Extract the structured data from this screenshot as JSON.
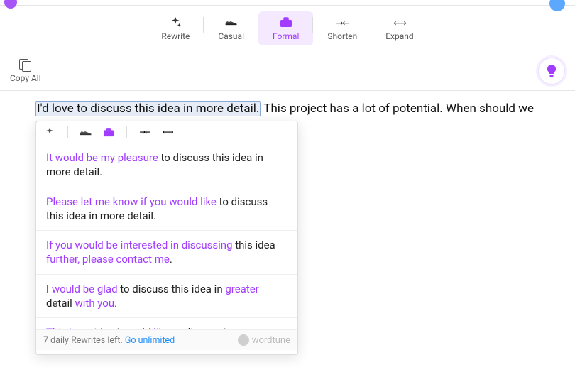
{
  "toolbar": {
    "rewrite": "Rewrite",
    "casual": "Casual",
    "formal": "Formal",
    "shorten": "Shorten",
    "expand": "Expand"
  },
  "actions": {
    "copy_all": "Copy All"
  },
  "editor": {
    "selected_sentence": "I'd love to discuss this idea in more detail.",
    "rest_text": "This project has a lot of potential. When should we set"
  },
  "popup": {
    "suggestions": [
      {
        "parts": [
          {
            "t": "It would be my pleasure",
            "hl": true
          },
          {
            "t": " to discuss this idea in more detail.",
            "hl": false
          }
        ]
      },
      {
        "parts": [
          {
            "t": "Please let me know if you would like",
            "hl": true
          },
          {
            "t": " to discuss this idea in more detail.",
            "hl": false
          }
        ]
      },
      {
        "parts": [
          {
            "t": "If you would be interested in discussing",
            "hl": true
          },
          {
            "t": " this idea ",
            "hl": false
          },
          {
            "t": "further, please contact me",
            "hl": true
          },
          {
            "t": ".",
            "hl": false
          }
        ]
      },
      {
        "parts": [
          {
            "t": "I ",
            "hl": false
          },
          {
            "t": "would be glad",
            "hl": true
          },
          {
            "t": " to discuss this idea in ",
            "hl": false
          },
          {
            "t": "greater",
            "hl": true
          },
          {
            "t": " detail ",
            "hl": false
          },
          {
            "t": "with you",
            "hl": true
          },
          {
            "t": ".",
            "hl": false
          }
        ]
      },
      {
        "parts": [
          {
            "t": "This is an idea",
            "hl": true
          },
          {
            "t": " I ",
            "hl": false
          },
          {
            "t": "would like",
            "hl": true
          },
          {
            "t": " to discuss in",
            "hl": false
          }
        ]
      }
    ],
    "footer_left": "7 daily Rewrites left. ",
    "footer_link": "Go unlimited",
    "brand": "wordtune"
  }
}
